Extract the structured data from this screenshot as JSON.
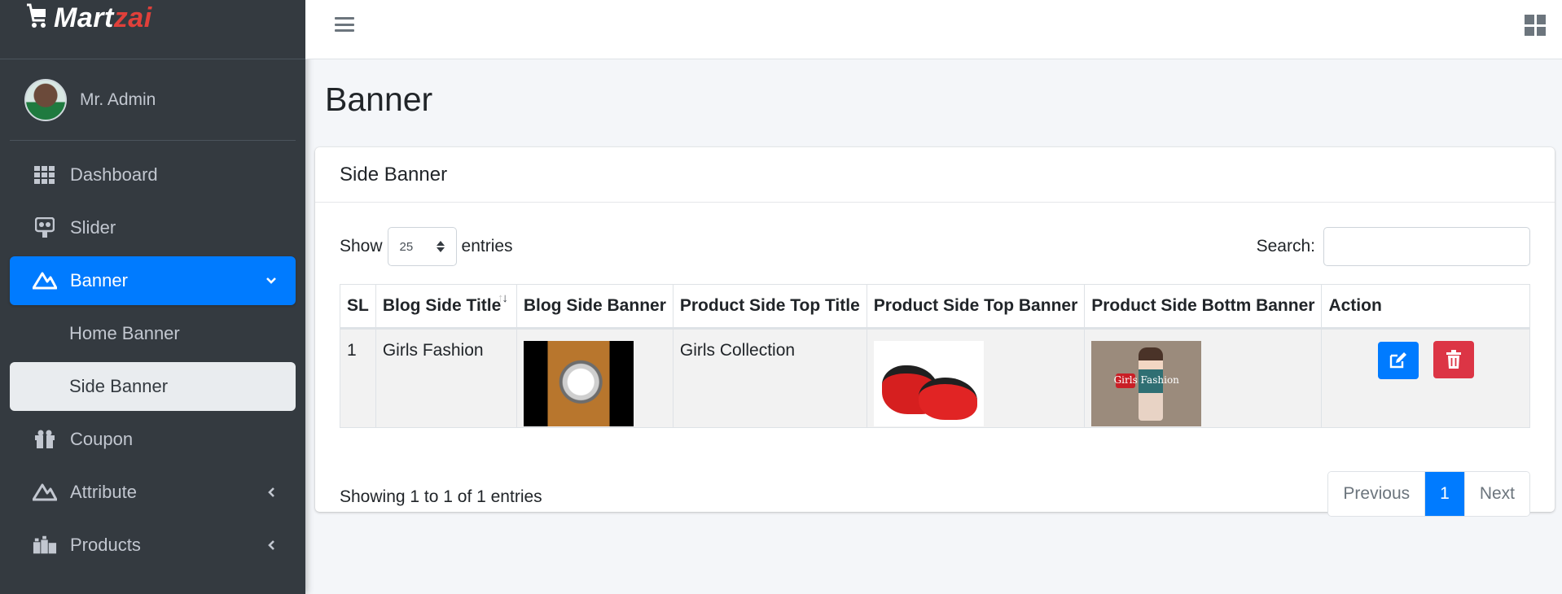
{
  "brand": {
    "part1": "Mart",
    "part2": "zai"
  },
  "user": {
    "name": "Mr. Admin"
  },
  "sidebar": {
    "items": [
      {
        "label": "Dashboard",
        "icon": "grid-icon"
      },
      {
        "label": "Slider",
        "icon": "slider-icon"
      },
      {
        "label": "Banner",
        "icon": "banner-icon",
        "active": true,
        "caret": "down"
      },
      {
        "label": "Home Banner"
      },
      {
        "label": "Side Banner",
        "active": true
      },
      {
        "label": "Coupon",
        "icon": "gift-icon"
      },
      {
        "label": "Attribute",
        "icon": "attribute-icon",
        "caret": "left"
      },
      {
        "label": "Products",
        "icon": "products-icon",
        "caret": "left"
      }
    ]
  },
  "page": {
    "title": "Banner"
  },
  "card": {
    "title": "Side Banner",
    "show_label": "Show",
    "entries_label": "entries",
    "page_length": "25",
    "search_label": "Search:",
    "search_value": ""
  },
  "table": {
    "headers": [
      "SL",
      "Blog Side Title",
      "Blog Side Banner",
      "Product Side Top Title",
      "Product Side Top Banner",
      "Product Side Bottm Banner",
      "Action"
    ],
    "rows": [
      {
        "sl": "1",
        "blog_title": "Girls Fashion",
        "blog_banner": "watch-image",
        "product_top_title": "Girls Collection",
        "product_top_banner": "red-shoes-image",
        "product_bottom_banner": "girls-fashion-image",
        "bottom_banner_caption": "Girls Fashion"
      }
    ]
  },
  "footer": {
    "info": "Showing 1 to 1 of 1 entries",
    "previous": "Previous",
    "current_page": "1",
    "next": "Next"
  },
  "colors": {
    "sidebar_bg": "#343a40",
    "primary": "#007bff",
    "danger": "#dc3545",
    "brand_accent": "#e0403a"
  }
}
